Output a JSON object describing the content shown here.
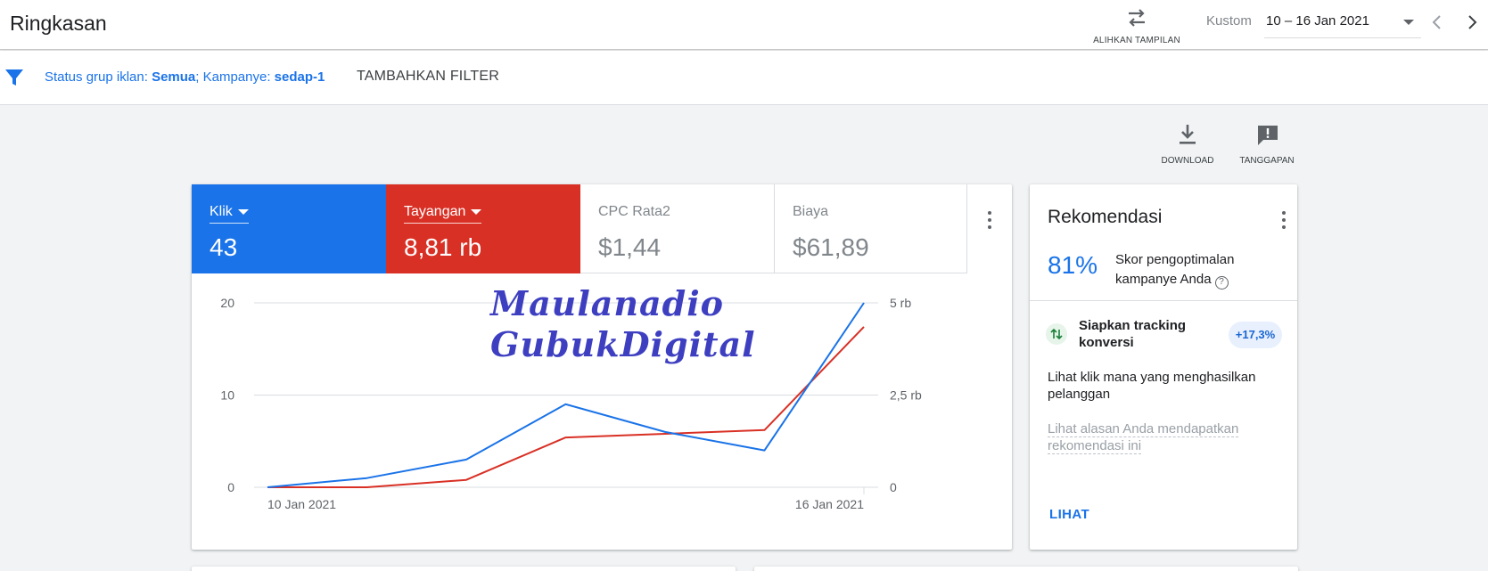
{
  "header": {
    "title": "Ringkasan",
    "switch_view_label": "ALIHKAN TAMPILAN",
    "range_label": "Kustom",
    "date_range": "10 – 16 Jan 2021"
  },
  "filter": {
    "status_label": "Status grup iklan:",
    "status_value": "Semua",
    "campaign_label": "; Kampanye:",
    "campaign_value": "sedap-1",
    "add_filter": "TAMBAHKAN FILTER"
  },
  "toolbar": {
    "download": "DOWNLOAD",
    "feedback": "TANGGAPAN"
  },
  "metrics": [
    {
      "name": "Klik",
      "value": "43",
      "color": "#1a73e8"
    },
    {
      "name": "Tayangan",
      "value": "8,81 rb",
      "color": "#d93025"
    },
    {
      "name": "CPC Rata2",
      "value": "$1,44"
    },
    {
      "name": "Biaya",
      "value": "$61,89"
    }
  ],
  "chart_data": {
    "type": "line",
    "x": [
      "10 Jan 2021",
      "11 Jan 2021",
      "12 Jan 2021",
      "13 Jan 2021",
      "14 Jan 2021",
      "15 Jan 2021",
      "16 Jan 2021"
    ],
    "x_tick_labels": [
      "10 Jan 2021",
      "16 Jan 2021"
    ],
    "series": [
      {
        "name": "Klik",
        "axis": "left",
        "color": "#1a73e8",
        "values": [
          0,
          1,
          3,
          9,
          6,
          4,
          20
        ]
      },
      {
        "name": "Tayangan",
        "axis": "right",
        "color": "#d93025",
        "values": [
          0,
          0,
          200,
          1350,
          1450,
          1550,
          4350
        ]
      }
    ],
    "y_left": {
      "ylim": [
        0,
        20
      ],
      "ticks": [
        0,
        10,
        20
      ],
      "tick_labels": [
        "0",
        "10",
        "20"
      ]
    },
    "y_right": {
      "ylim": [
        0,
        5000
      ],
      "ticks": [
        0,
        2500,
        5000
      ],
      "tick_labels": [
        "0",
        "2,5 rb",
        "5 rb"
      ]
    },
    "grid": true
  },
  "recommendation": {
    "title": "Rekomendasi",
    "score": "81%",
    "score_desc": "Skor pengoptimalan kampanye Anda",
    "help_icon": "?",
    "item_title": "Siapkan tracking konversi",
    "item_badge": "+17,3%",
    "item_body": "Lihat klik mana yang menghasilkan pelanggan",
    "why_link": "Lihat alasan Anda mendapatkan rekomendasi ini",
    "view_button": "LIHAT"
  },
  "watermark": {
    "line1": "Maulanadio",
    "line2": "GubukDigital"
  }
}
